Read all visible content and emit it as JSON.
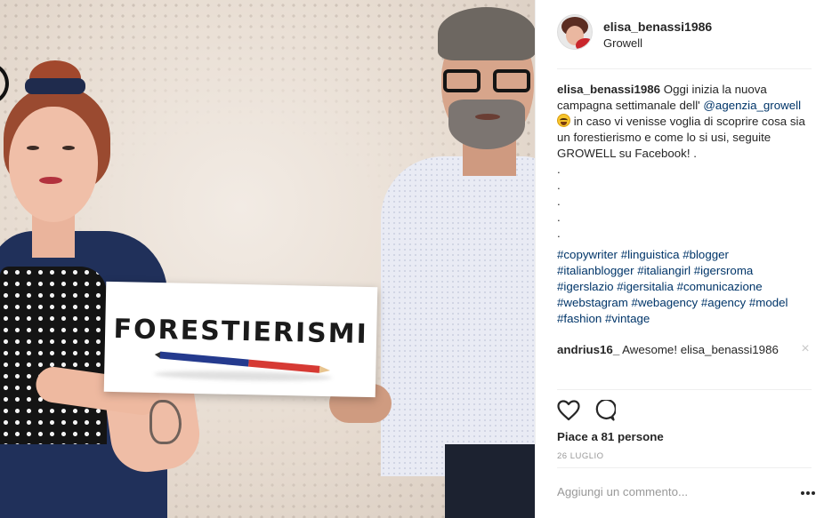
{
  "post": {
    "username": "elisa_benassi1986",
    "location": "Growell",
    "sign_text": "FORESTIERISMI"
  },
  "caption": {
    "username": "elisa_benassi1986",
    "text_1": " Oggi inizia la nuova campagna settimanale dell' ",
    "mention": "@agenzia_growell",
    "text_2": " in caso vi venisse voglia di scoprire cosa sia un forestierismo e come lo si usi, seguite GROWELL su Facebook! .",
    "dots": [
      ".",
      ".",
      ".",
      ".",
      "."
    ],
    "hashtags": [
      "#copywriter",
      "#linguistica",
      "#blogger",
      "#italianblogger",
      "#italiangirl",
      "#igersroma",
      "#igerslazio",
      "#igersitalia",
      "#comunicazione",
      "#webstagram",
      "#webagency",
      "#agency",
      "#model",
      "#fashion",
      "#vintage"
    ]
  },
  "reply": {
    "username": "andrius16_",
    "text": " Awesome! elisa_benassi1986",
    "close_icon": "×"
  },
  "actions": {
    "likes": "Piace a 81 persone",
    "date": "26 LUGLIO",
    "add_comment_placeholder": "Aggiungi un commento..."
  },
  "colors": {
    "link": "#003569",
    "muted": "#999999",
    "text": "#262626"
  }
}
